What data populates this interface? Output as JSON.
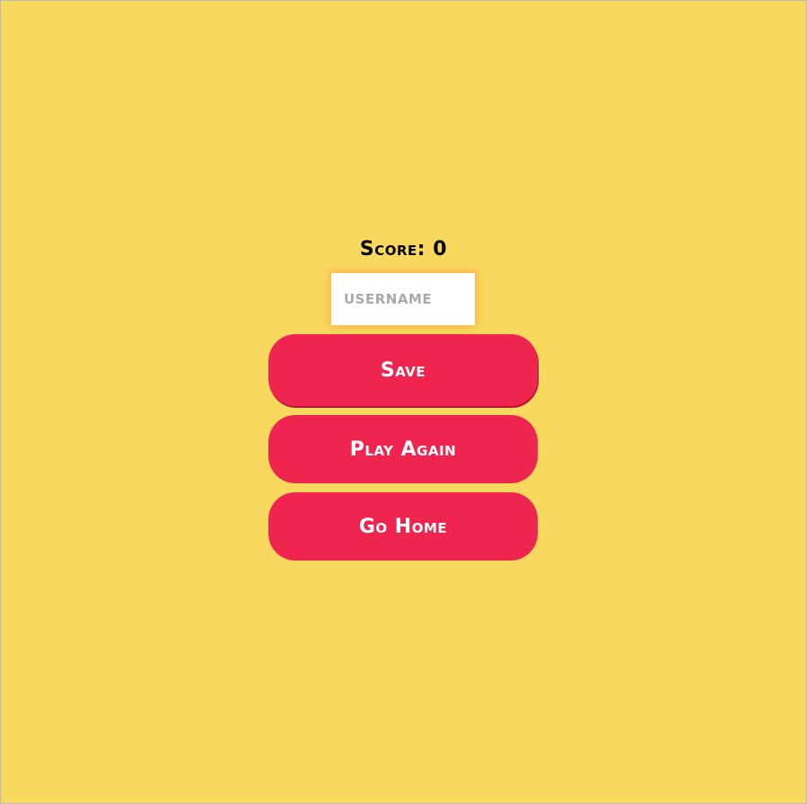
{
  "colors": {
    "background": "#f9d95d",
    "button": "#ef2550",
    "button_text": "#ffffff",
    "input_glow": "#ffa13c",
    "score_text": "#000000"
  },
  "score": {
    "label": "Score: 0"
  },
  "username": {
    "value": "",
    "placeholder": "USERNAME"
  },
  "buttons": {
    "save_label": "Save",
    "play_again_label": "Play Again",
    "go_home_label": "Go Home"
  }
}
